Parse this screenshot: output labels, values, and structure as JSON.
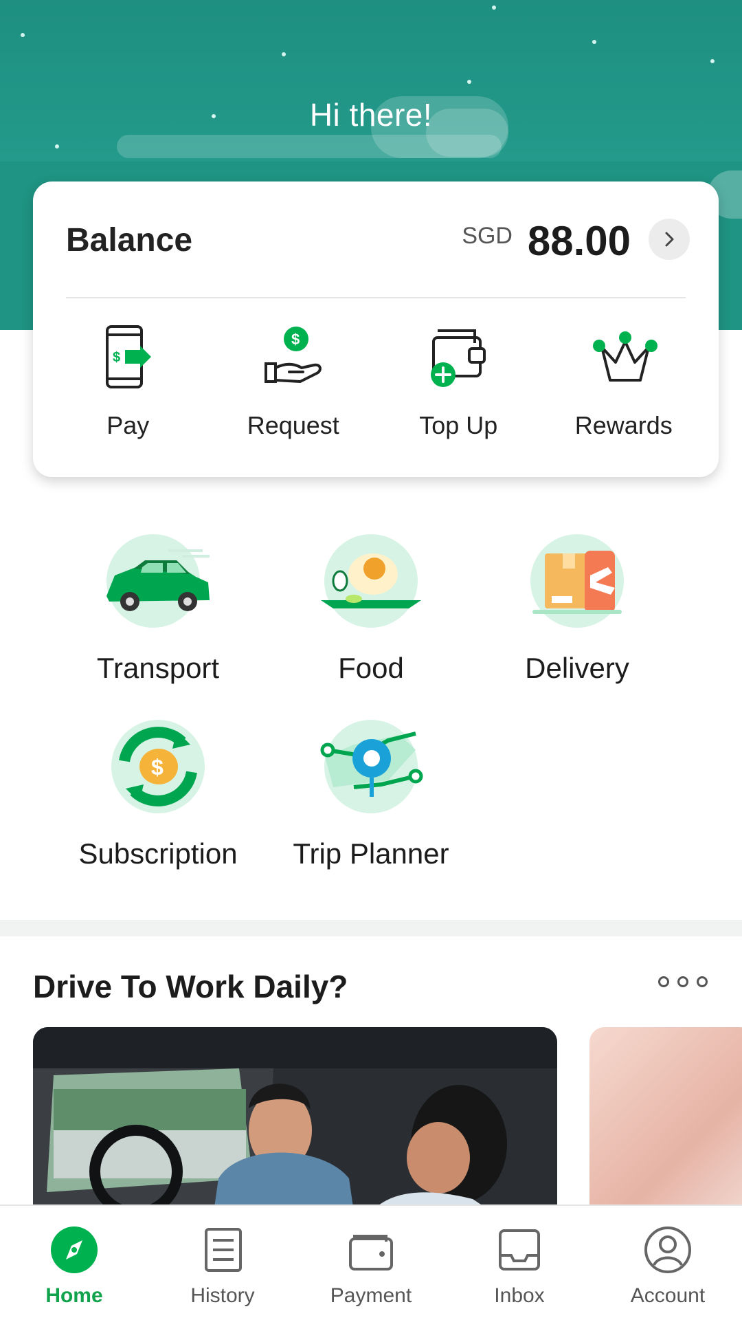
{
  "header": {
    "greeting": "Hi there!"
  },
  "balance": {
    "title": "Balance",
    "currency": "SGD",
    "amount": "88.00"
  },
  "quick_actions": [
    {
      "label": "Pay",
      "icon": "pay-icon"
    },
    {
      "label": "Request",
      "icon": "request-icon"
    },
    {
      "label": "Top Up",
      "icon": "top-up-icon"
    },
    {
      "label": "Rewards",
      "icon": "rewards-icon"
    }
  ],
  "services": [
    {
      "label": "Transport",
      "icon": "transport-icon"
    },
    {
      "label": "Food",
      "icon": "food-icon"
    },
    {
      "label": "Delivery",
      "icon": "delivery-icon"
    },
    {
      "label": "Subscription",
      "icon": "subscription-icon"
    },
    {
      "label": "Trip Planner",
      "icon": "trip-planner-icon"
    }
  ],
  "promo": {
    "title": "Drive To Work Daily?"
  },
  "bottom_nav": [
    {
      "label": "Home",
      "icon": "home-compass-icon",
      "active": true
    },
    {
      "label": "History",
      "icon": "history-icon",
      "active": false
    },
    {
      "label": "Payment",
      "icon": "wallet-icon",
      "active": false
    },
    {
      "label": "Inbox",
      "icon": "inbox-icon",
      "active": false
    },
    {
      "label": "Account",
      "icon": "account-icon",
      "active": false
    }
  ],
  "colors": {
    "brand_green": "#00b14f",
    "header_teal": "#1f9484",
    "active_nav": "#11a24c"
  }
}
